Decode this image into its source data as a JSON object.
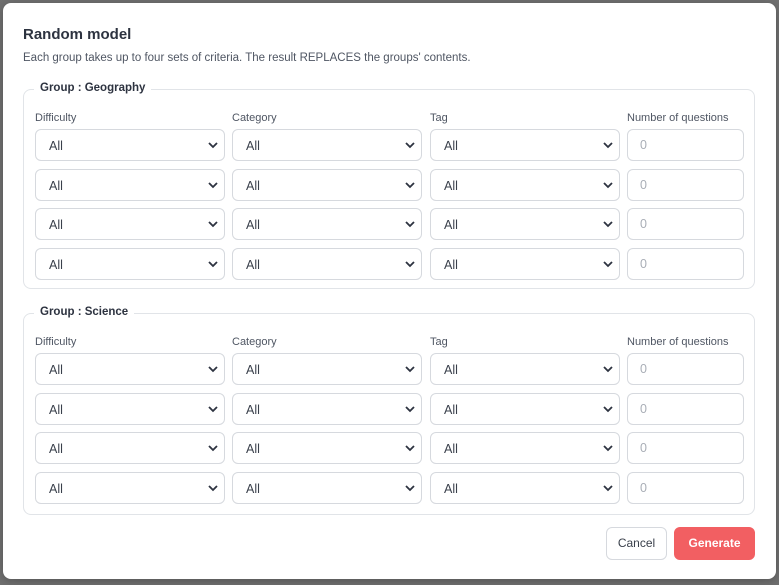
{
  "modal": {
    "title": "Random model",
    "description": "Each group takes up to four sets of criteria. The result REPLACES the groups' contents."
  },
  "columns": {
    "difficulty": "Difficulty",
    "category": "Category",
    "tag": "Tag",
    "count": "Number of questions"
  },
  "groups": [
    {
      "legend": "Group : Geography",
      "rows": [
        {
          "difficulty": "All",
          "category": "All",
          "tag": "All",
          "count_placeholder": "0"
        },
        {
          "difficulty": "All",
          "category": "All",
          "tag": "All",
          "count_placeholder": "0"
        },
        {
          "difficulty": "All",
          "category": "All",
          "tag": "All",
          "count_placeholder": "0"
        },
        {
          "difficulty": "All",
          "category": "All",
          "tag": "All",
          "count_placeholder": "0"
        }
      ]
    },
    {
      "legend": "Group : Science",
      "rows": [
        {
          "difficulty": "All",
          "category": "All",
          "tag": "All",
          "count_placeholder": "0"
        },
        {
          "difficulty": "All",
          "category": "All",
          "tag": "All",
          "count_placeholder": "0"
        },
        {
          "difficulty": "All",
          "category": "All",
          "tag": "All",
          "count_placeholder": "0"
        },
        {
          "difficulty": "All",
          "category": "All",
          "tag": "All",
          "count_placeholder": "0"
        }
      ]
    }
  ],
  "buttons": {
    "cancel": "Cancel",
    "generate": "Generate"
  },
  "colors": {
    "accent": "#f25f62",
    "border": "#d6d9de"
  },
  "icons": {
    "select_arrow": "chevron-down-icon"
  }
}
